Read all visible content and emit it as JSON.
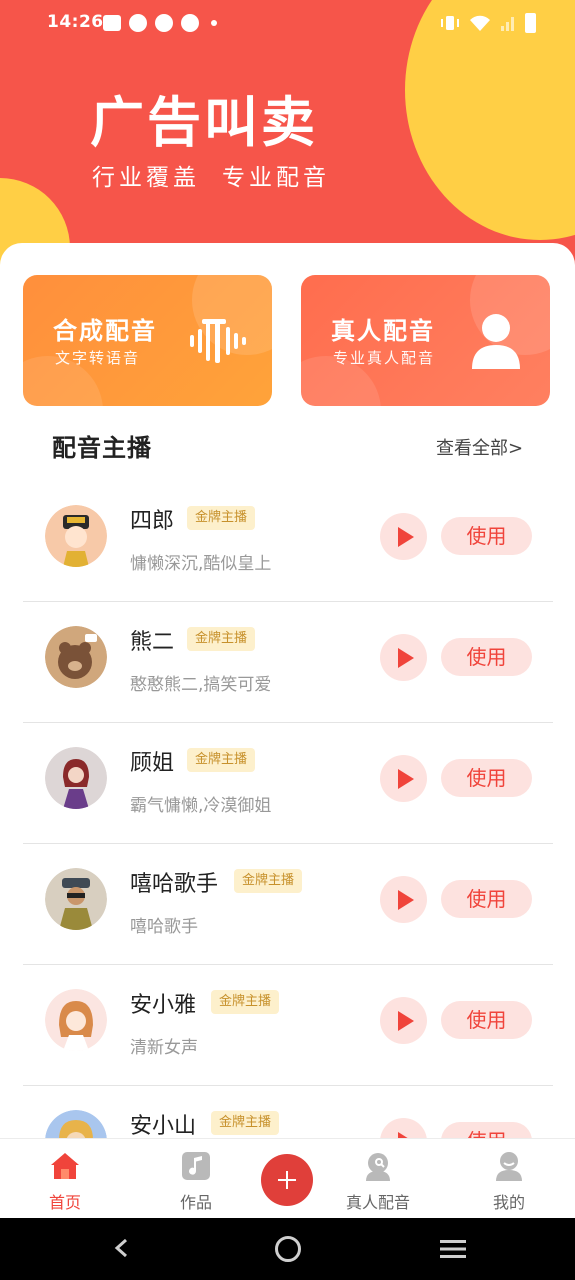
{
  "status_bar": {
    "time": "14:26",
    "left_icons": [
      "mail-icon",
      "notification-icon",
      "notification-icon",
      "notification-icon",
      "dot-icon"
    ],
    "right_icons": [
      "vibrate-icon",
      "wifi-icon",
      "signal-icon",
      "battery-icon"
    ]
  },
  "hero": {
    "title": "广告叫卖",
    "subtitle_1": "行业覆盖",
    "subtitle_2": "专业配音",
    "colors": {
      "background": "#f6554a",
      "accent": "#ffcf45"
    }
  },
  "features": [
    {
      "title": "合成配音",
      "subtitle": "文字转语音",
      "icon": "waveform-icon",
      "color": "#ff9a3a"
    },
    {
      "title": "真人配音",
      "subtitle": "专业真人配音",
      "icon": "person-icon",
      "color": "#ff7455"
    }
  ],
  "section": {
    "title": "配音主播",
    "view_all": "查看全部>"
  },
  "anchors": [
    {
      "name": "四郎",
      "badge": "金牌主播",
      "desc": "慵懒深沉,酷似皇上",
      "use_label": "使用"
    },
    {
      "name": "熊二",
      "badge": "金牌主播",
      "desc": "憨憨熊二,搞笑可爱",
      "use_label": "使用"
    },
    {
      "name": "顾姐",
      "badge": "金牌主播",
      "desc": "霸气慵懒,冷漠御姐",
      "use_label": "使用"
    },
    {
      "name": "嘻哈歌手",
      "badge": "金牌主播",
      "desc": "嘻哈歌手",
      "use_label": "使用"
    },
    {
      "name": "安小雅",
      "badge": "金牌主播",
      "desc": "清新女声",
      "use_label": "使用"
    },
    {
      "name": "安小山",
      "badge": "金牌主播",
      "desc": "",
      "use_label": "使用"
    }
  ],
  "tabbar": {
    "tabs": [
      {
        "label": "首页",
        "icon": "home-icon",
        "active": true
      },
      {
        "label": "作品",
        "icon": "music-note-icon",
        "active": false
      },
      {
        "label": "真人配音",
        "icon": "headset-person-icon",
        "active": false
      },
      {
        "label": "我的",
        "icon": "profile-icon",
        "active": false
      }
    ],
    "fab_icon": "plus-icon",
    "colors": {
      "active": "#f0443b",
      "inactive": "#666666"
    }
  },
  "navbar": {
    "icons": [
      "back-icon",
      "home-circle-icon",
      "menu-icon"
    ]
  }
}
